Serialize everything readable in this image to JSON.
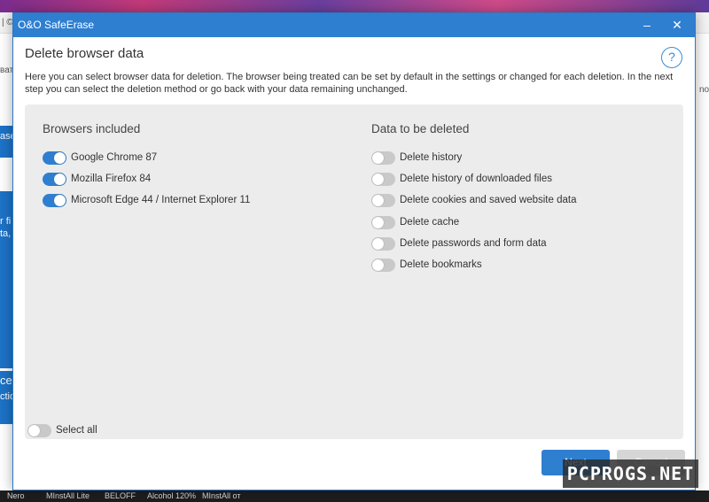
{
  "background": {
    "toolbar_fragments": [
      "| ©",
      "вать"
    ],
    "right_fragment": "no",
    "side_fragments": [
      "ase",
      "r fi",
      "ta,",
      "ce",
      "ction"
    ],
    "taskbar_items": [
      "Nero",
      "MInstAll Lite",
      "BELOFF",
      "Alcohol 120%",
      "MInstAll от"
    ]
  },
  "window": {
    "title": "O&O SafeErase",
    "minimize_glyph": "–",
    "close_glyph": "✕"
  },
  "header": {
    "title": "Delete browser data",
    "help_glyph": "?"
  },
  "description": "Here you can select browser data for deletion. The browser being treated can be set by default in the settings or changed for each deletion. In the next step you can select the deletion method or go back with your data remaining unchanged.",
  "browsers": {
    "heading": "Browsers included",
    "items": [
      {
        "label": "Google Chrome 87",
        "checked": true
      },
      {
        "label": "Mozilla Firefox 84",
        "checked": true
      },
      {
        "label": "Microsoft Edge 44 / Internet Explorer 11",
        "checked": true
      }
    ]
  },
  "data_options": {
    "heading": "Data to be deleted",
    "items": [
      {
        "label": "Delete history",
        "checked": false
      },
      {
        "label": "Delete history of downloaded files",
        "checked": false
      },
      {
        "label": "Delete cookies and saved website data",
        "checked": false
      },
      {
        "label": "Delete cache",
        "checked": false
      },
      {
        "label": "Delete passwords and form data",
        "checked": false
      },
      {
        "label": "Delete bookmarks",
        "checked": false
      }
    ]
  },
  "select_all": {
    "label": "Select all",
    "checked": false
  },
  "buttons": {
    "next": "Next",
    "cancel": "Cancel"
  },
  "watermark": "PCPROGS.NET",
  "colors": {
    "accent": "#2f7fd0",
    "panel": "#ececec",
    "toggle_off": "#c9c9c9"
  }
}
